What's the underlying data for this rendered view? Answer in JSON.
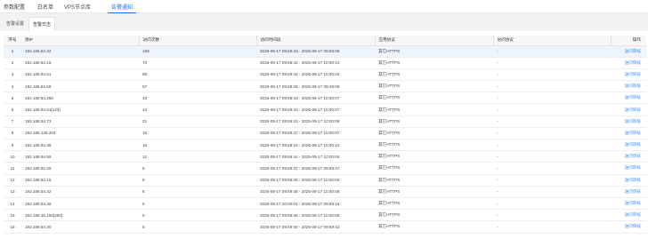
{
  "top_tabs": [
    {
      "label": "参数配置"
    },
    {
      "label": "白名单"
    },
    {
      "label": "VPS节点库"
    },
    {
      "label": "告警通知"
    }
  ],
  "sub_tabs": [
    {
      "label": "告警设置"
    },
    {
      "label": "告警日志"
    }
  ],
  "columns": {
    "index": "序号",
    "source_ip": "源IP",
    "count": "访问次数",
    "time_range": "访问时间段",
    "app_protocol": "应用协议",
    "visit_protocol": "访问协议",
    "action": "操作"
  },
  "rows": [
    {
      "index": "1",
      "ip": "192.168.84.32",
      "count": "169",
      "time": "2025-09-17 09:59:43 - 2025-09-17 09:59:06",
      "app": "其它HTTPS",
      "proto": "-",
      "action": "送问审核"
    },
    {
      "index": "2",
      "ip": "192.168.84.16",
      "count": "70",
      "time": "2025-09-17 09:59:42 - 2025-09-17 10:00:10",
      "app": "其它HTTPS",
      "proto": "-",
      "action": "送问审核"
    },
    {
      "index": "3",
      "ip": "192.168.84.51",
      "count": "58",
      "time": "2025-09-17 09:59:44 - 2025-09-17 10:00:03",
      "app": "其它HTTPS",
      "proto": "-",
      "action": "送问审核"
    },
    {
      "index": "4",
      "ip": "192.168.84.58",
      "count": "57",
      "time": "2025-09-17 09:58:28 - 2025-09-17 09:48:08",
      "app": "其它HTTPS",
      "proto": "-",
      "action": "送问审核"
    },
    {
      "index": "5",
      "ip": "192.168.84.250",
      "count": "33",
      "time": "2025-09-17 09:59:43 - 2025-09-17 10:00:07",
      "app": "其它HTTPS",
      "proto": "-",
      "action": "送问审核"
    },
    {
      "index": "6",
      "ip": "192.168.84.61[123]",
      "count": "24",
      "time": "2025-09-17 09:59:43 - 2025-09-17 10:00:07",
      "app": "其它HTTPS",
      "proto": "-",
      "action": "送问审核"
    },
    {
      "index": "7",
      "ip": "192.168.84.73",
      "count": "21",
      "time": "2025-09-17 09:59:43 - 2025-09-17 10:00:08",
      "app": "其它HTTPS",
      "proto": "-",
      "action": "送问审核"
    },
    {
      "index": "8",
      "ip": "192.168.128.204",
      "count": "16",
      "time": "2025-09-17 09:59:47 - 2025-09-17 10:00:07",
      "app": "其它HTTPS",
      "proto": "-",
      "action": "送问审核"
    },
    {
      "index": "9",
      "ip": "192.168.84.38",
      "count": "15",
      "time": "2025-09-17 09:58:16 - 2025-09-17 10:00:10",
      "app": "其它HTTPS",
      "proto": "-",
      "action": "送问审核"
    },
    {
      "index": "10",
      "ip": "192.168.84.59",
      "count": "12",
      "time": "2025-09-17 09:59:44 - 2025-09-17 10:00:04",
      "app": "其它HTTPS",
      "proto": "-",
      "action": "送问审核"
    },
    {
      "index": "11",
      "ip": "192.168.82.28",
      "count": "8",
      "time": "2025-09-17 09:59:37 - 2025-09-17 09:59:47",
      "app": "其它HTTPS",
      "proto": "-",
      "action": "送问审核"
    },
    {
      "index": "12",
      "ip": "192.168.84.15",
      "count": "8",
      "time": "2025-09-17 09:59:45 - 2025-09-17 10:00:05",
      "app": "其它HTTPS",
      "proto": "-",
      "action": "送问审核"
    },
    {
      "index": "13",
      "ip": "192.168.84.42",
      "count": "6",
      "time": "2025-09-17 09:59:48 - 2025-09-17 10:00:08",
      "app": "其它HTTPS",
      "proto": "-",
      "action": "送问审核"
    },
    {
      "index": "14",
      "ip": "192.168.84.36",
      "count": "6",
      "time": "2025-09-17 10:00:01 - 2025-09-17 09:59:15",
      "app": "其它HTTPS",
      "proto": "-",
      "action": "送问审核"
    },
    {
      "index": "15",
      "ip": "192.168.45.150[450]",
      "count": "5",
      "time": "2025-09-17 09:59:49 - 2025-09-17 10:00:08",
      "app": "其它HTTPS",
      "proto": "-",
      "action": "送问审核"
    },
    {
      "index": "16",
      "ip": "192.168.84.30",
      "count": "5",
      "time": "2025-09-17 09:59:40 - 2025-09-17 09:59:42",
      "app": "其它HTTPS",
      "proto": "-",
      "action": "送问审核"
    }
  ],
  "colors": {
    "accent": "#1a73e8",
    "link": "#4a8fe0",
    "highlight_row": "#eef4fc"
  }
}
